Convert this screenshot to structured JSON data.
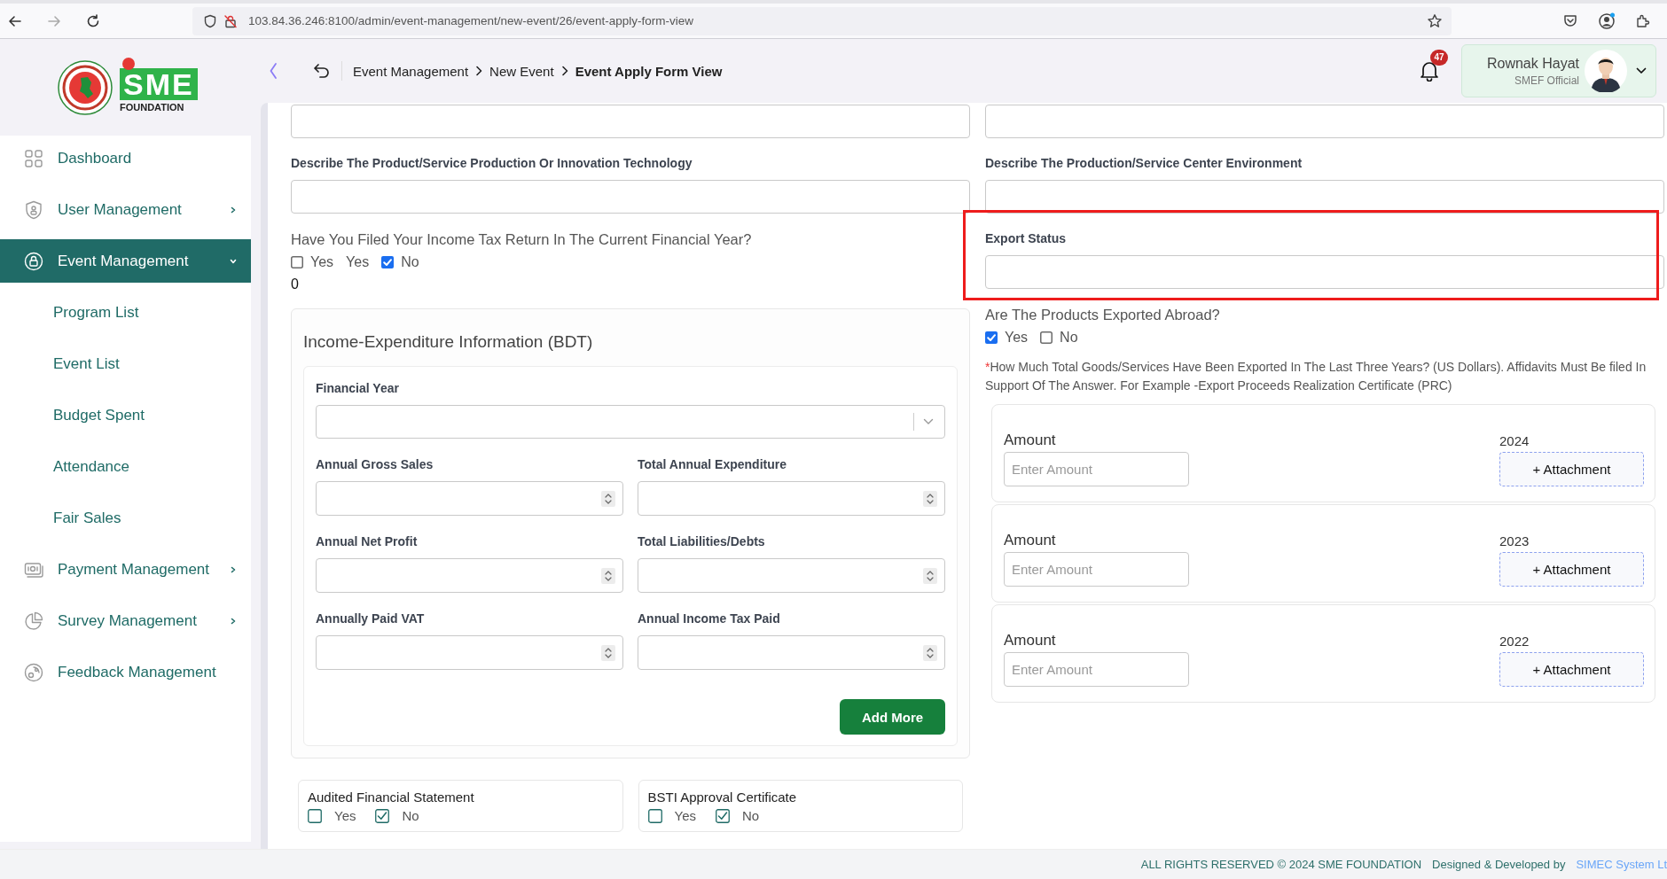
{
  "browser": {
    "url": "103.84.36.246:8100/admin/event-management/new-event/26/event-apply-form-view"
  },
  "logo": {
    "name": "SME",
    "tagline": "FOUNDATION"
  },
  "header": {
    "breadcrumb": [
      {
        "label": "Event Management",
        "current": false
      },
      {
        "label": "New Event",
        "current": false
      },
      {
        "label": "Event Apply Form View",
        "current": true
      }
    ],
    "notification_count": "47",
    "user": {
      "name": "Rownak Hayat",
      "role": "SMEF Official"
    }
  },
  "sidebar": {
    "items": [
      {
        "label": "Dashboard",
        "kind": "link",
        "selected": false
      },
      {
        "label": "User Management",
        "kind": "group",
        "selected": false,
        "expanded": false
      },
      {
        "label": "Event Management",
        "kind": "group",
        "selected": true,
        "expanded": true,
        "children": [
          {
            "label": "Program List",
            "selected": false
          },
          {
            "label": "Event List",
            "selected": false
          },
          {
            "label": "Budget Spent",
            "selected": false
          },
          {
            "label": "Attendance",
            "selected": false
          },
          {
            "label": "Fair Sales",
            "selected": false
          }
        ]
      },
      {
        "label": "Payment Management",
        "kind": "group",
        "selected": false,
        "expanded": false
      },
      {
        "label": "Survey Management",
        "kind": "group",
        "selected": false,
        "expanded": false
      },
      {
        "label": "Feedback Management",
        "kind": "link",
        "selected": false
      }
    ]
  },
  "form": {
    "left": [
      {
        "kind": "text_input"
      },
      {
        "kind": "text_input",
        "label": "Describe The Product/Service Production Or Innovation Technology"
      },
      {
        "kind": "choice",
        "question": "Have You Filed Your Income Tax Return In The Current Financial Year?",
        "options": [
          {
            "kind": "checkbox",
            "label": "Yes",
            "checked": false
          },
          {
            "kind": "text",
            "label": "Yes"
          },
          {
            "kind": "checkbox",
            "label": "No",
            "checked": true
          }
        ],
        "value": "0"
      },
      {
        "kind": "section",
        "title": "Income-Expenditure Information (BDT)",
        "select_label": "Financial Year",
        "fields": [
          {
            "label": "Annual Gross Sales"
          },
          {
            "label": "Total Annual Expenditure"
          },
          {
            "label": "Annual Net Profit"
          },
          {
            "label": "Total Liabilities/Debts"
          },
          {
            "label": "Annually Paid VAT"
          },
          {
            "label": "Annual Income Tax Paid"
          }
        ],
        "button": "Add More"
      },
      {
        "kind": "certificates",
        "items": [
          {
            "label": "Audited Financial Statement",
            "options": [
              {
                "label": "Yes",
                "checked": false
              },
              {
                "label": "No",
                "checked": true
              }
            ]
          },
          {
            "label": "BSTI Approval Certificate",
            "options": [
              {
                "label": "Yes",
                "checked": false
              },
              {
                "label": "No",
                "checked": true
              }
            ]
          }
        ]
      }
    ],
    "right": [
      {
        "kind": "text_input"
      },
      {
        "kind": "text_input",
        "label": "Describe The Production/Service Center Environment"
      },
      {
        "kind": "text_input",
        "label": "Export Status",
        "highlighted": true
      },
      {
        "kind": "choice",
        "question": "Are The Products Exported Abroad?",
        "options": [
          {
            "kind": "checkbox",
            "label": "Yes",
            "checked": true
          },
          {
            "kind": "checkbox",
            "label": "No",
            "checked": false
          }
        ]
      },
      {
        "kind": "note",
        "marker": "*",
        "text": "How Much Total Goods/Services Have Been Exported In The Last Three Years? (US Dollars). Affidavits Must Be filed In Support Of The Answer. For Example -Export Proceeds Realization Certificate (PRC)"
      },
      {
        "kind": "amounts",
        "rows": [
          {
            "label": "Amount",
            "placeholder": "Enter Amount",
            "year": "2024",
            "button": "+ Attachment"
          },
          {
            "label": "Amount",
            "placeholder": "Enter Amount",
            "year": "2023",
            "button": "+ Attachment"
          },
          {
            "label": "Amount",
            "placeholder": "Enter Amount",
            "year": "2022",
            "button": "+ Attachment"
          }
        ]
      }
    ]
  },
  "footer": {
    "copyright": "ALL RIGHTS RESERVED © 2024 SME FOUNDATION",
    "credit": "Designed & Developed by",
    "credit_link": "SIMEC System Lt"
  }
}
